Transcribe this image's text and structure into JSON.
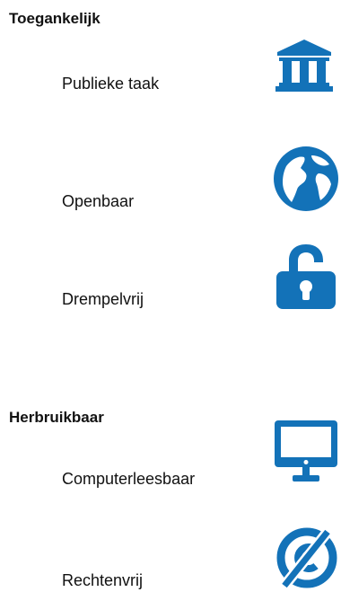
{
  "colors": {
    "accent": "#1372b8",
    "text": "#111111"
  },
  "sections": [
    {
      "title": "Toegankelijk",
      "items": [
        {
          "label": "Publieke taak",
          "icon": "government-building-icon"
        },
        {
          "label": "Openbaar",
          "icon": "globe-icon"
        },
        {
          "label": "Drempelvrij",
          "icon": "unlocked-padlock-icon"
        }
      ]
    },
    {
      "title": "Herbruikbaar",
      "items": [
        {
          "label": "Computerleesbaar",
          "icon": "computer-monitor-icon"
        },
        {
          "label": "Rechtenvrij",
          "icon": "no-copyright-icon"
        }
      ]
    }
  ]
}
